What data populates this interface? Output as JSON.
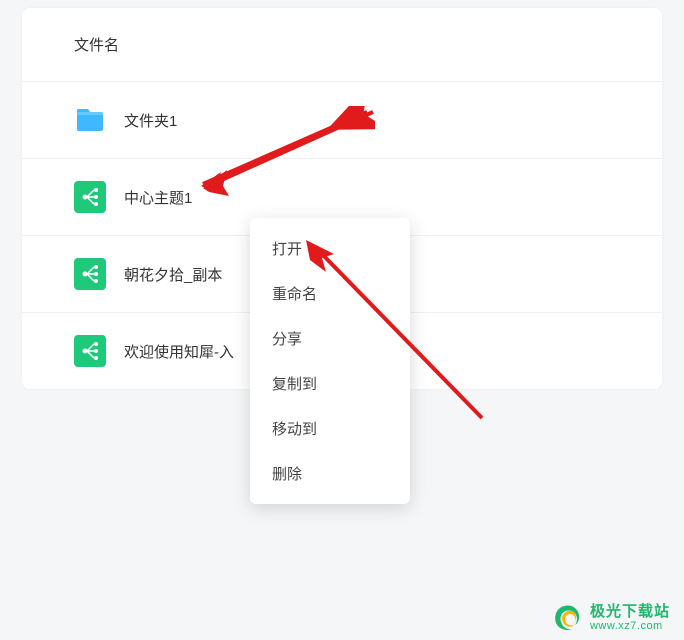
{
  "header": {
    "column_label": "文件名"
  },
  "files": [
    {
      "name": "文件夹1",
      "type": "folder"
    },
    {
      "name": "中心主题1",
      "type": "doc"
    },
    {
      "name": "朝花夕拾_副本",
      "type": "doc"
    },
    {
      "name": "欢迎使用知犀-入",
      "type": "doc"
    }
  ],
  "context_menu": {
    "items": [
      {
        "label": "打开"
      },
      {
        "label": "重命名"
      },
      {
        "label": "分享"
      },
      {
        "label": "复制到"
      },
      {
        "label": "移动到"
      },
      {
        "label": "删除"
      }
    ]
  },
  "watermark": {
    "title": "极光下载站",
    "url": "www.xz7.com"
  },
  "colors": {
    "folder": "#3eb8ff",
    "doc": "#1fc97a",
    "arrow": "#e11b1b",
    "brand": "#1fb86c"
  }
}
